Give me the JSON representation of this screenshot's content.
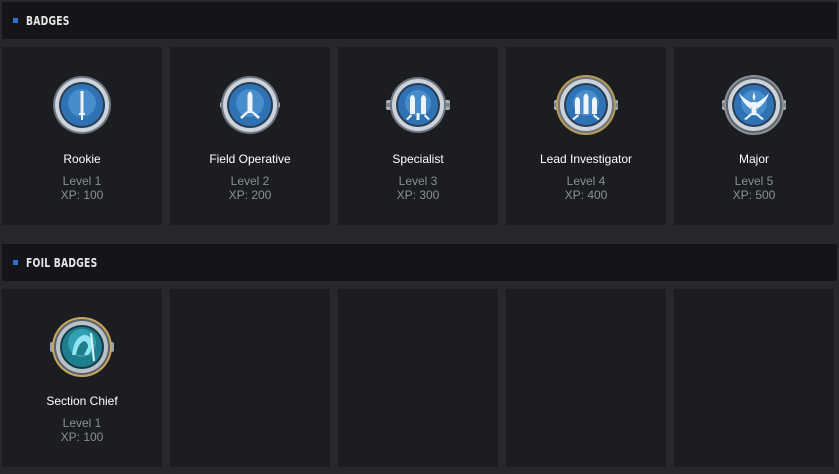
{
  "sections": [
    {
      "title": "BADGES",
      "badges": [
        {
          "name": "Rookie",
          "level": "Level 1",
          "xp": "XP: 100",
          "icon": "rookie-badge-icon"
        },
        {
          "name": "Field Operative",
          "level": "Level 2",
          "xp": "XP: 200",
          "icon": "field-operative-badge-icon"
        },
        {
          "name": "Specialist",
          "level": "Level 3",
          "xp": "XP: 300",
          "icon": "specialist-badge-icon"
        },
        {
          "name": "Lead Investigator",
          "level": "Level 4",
          "xp": "XP: 400",
          "icon": "lead-investigator-badge-icon"
        },
        {
          "name": "Major",
          "level": "Level 5",
          "xp": "XP: 500",
          "icon": "major-badge-icon"
        }
      ]
    },
    {
      "title": "FOIL BADGES",
      "badges": [
        {
          "name": "Section Chief",
          "level": "Level 1",
          "xp": "XP: 100",
          "icon": "section-chief-foil-badge-icon"
        }
      ]
    }
  ],
  "colors": {
    "accent": "#2f6fd0",
    "background": "#26282c",
    "header": "#141518",
    "card": "#1b1d21",
    "muted_text": "#8b8e93",
    "foil_accent": "#3fb7c9"
  }
}
